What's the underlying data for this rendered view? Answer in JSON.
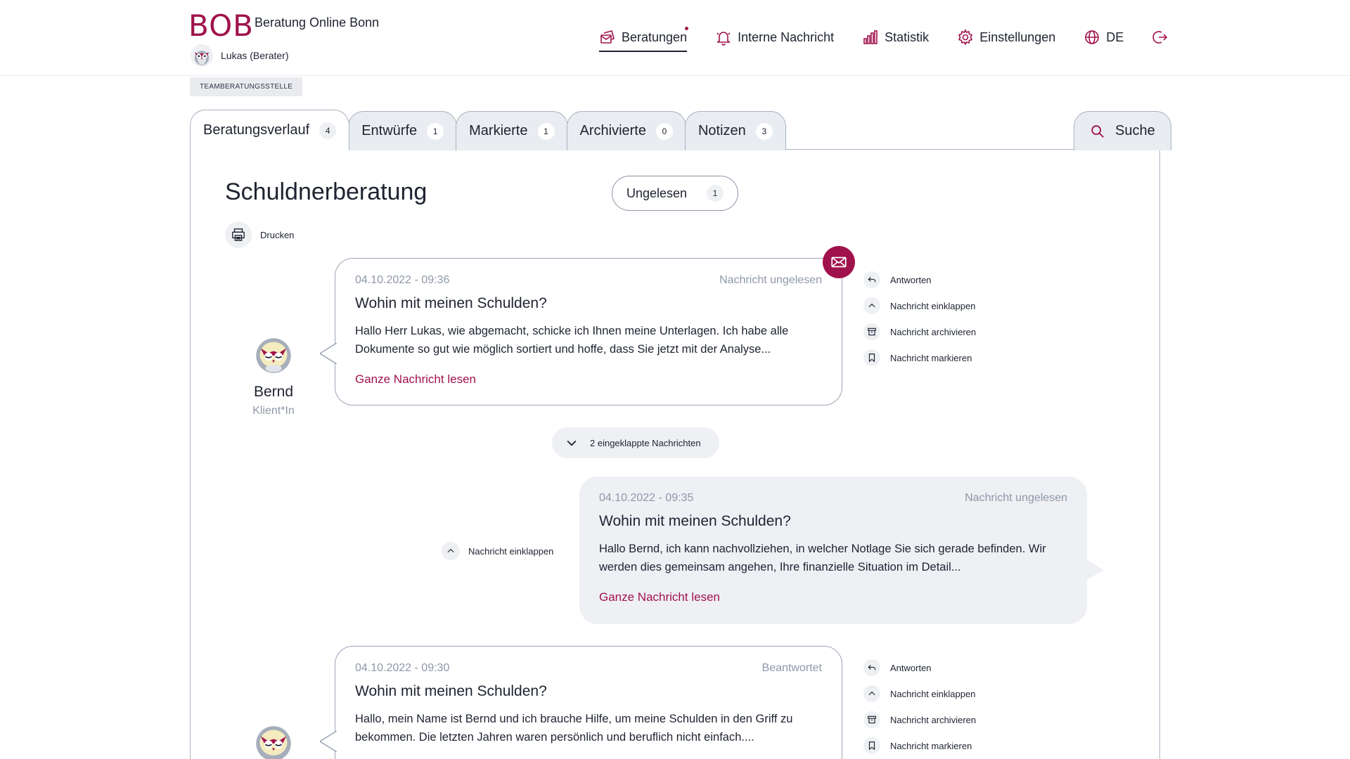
{
  "header": {
    "logo": "BOB",
    "org_name": "Beratung Online Bonn",
    "user_name": "Lukas (Berater)",
    "nav": {
      "beratungen": "Beratungen",
      "interne": "Interne Nachricht",
      "statistik": "Statistik",
      "einstellungen": "Einstellungen",
      "language": "DE"
    }
  },
  "team_badge": "TEAMBERATUNGSSTELLE",
  "tabs": [
    {
      "label": "Beratungsverlauf",
      "count": "4"
    },
    {
      "label": "Entwürfe",
      "count": "1"
    },
    {
      "label": "Markierte",
      "count": "1"
    },
    {
      "label": "Archivierte",
      "count": "0"
    },
    {
      "label": "Notizen",
      "count": "3"
    }
  ],
  "search_label": "Suche",
  "page_title": "Schuldnerberatung",
  "unread_filter": {
    "label": "Ungelesen",
    "count": "1"
  },
  "print_label": "Drucken",
  "messages": [
    {
      "timestamp": "04.10.2022 - 09:36",
      "status": "Nachricht ungelesen",
      "subject": "Wohin mit meinen Schulden?",
      "body": "Hallo Herr Lukas, wie abgemacht, schicke ich Ihnen meine Unterlagen. Ich habe alle Dokumente so gut wie möglich sortiert und hoffe, dass Sie jetzt mit der Analyse...",
      "link": "Ganze Nachricht lesen"
    },
    {
      "timestamp": "04.10.2022 - 09:35",
      "status": "Nachricht ungelesen",
      "subject": "Wohin mit meinen Schulden?",
      "body": "Hallo Bernd, ich kann nachvollziehen, in welcher Notlage Sie sich gerade befinden. Wir werden dies gemeinsam angehen, Ihre finanzielle Situation im Detail...",
      "link": "Ganze Nachricht lesen"
    },
    {
      "timestamp": "04.10.2022 - 09:30",
      "status": "Beantwortet",
      "subject": "Wohin mit meinen Schulden?",
      "body": "Hallo, mein Name ist Bernd und ich brauche Hilfe, um meine Schulden in den Griff zu bekommen.  Die letzten Jahren waren persönlich und beruflich nicht einfach...."
    }
  ],
  "sender": {
    "name": "Bernd",
    "role": "Klient*In"
  },
  "actions": {
    "reply": "Antworten",
    "collapse": "Nachricht einklappen",
    "archive": "Nachricht archivieren",
    "mark": "Nachricht markieren"
  },
  "collapsed_label": "2 eingeklappte Nachrichten",
  "colors": {
    "brand": "#a0124b",
    "border": "#aab3c1",
    "muted": "#8f98a8",
    "tab_bg": "#e9ecf1"
  }
}
